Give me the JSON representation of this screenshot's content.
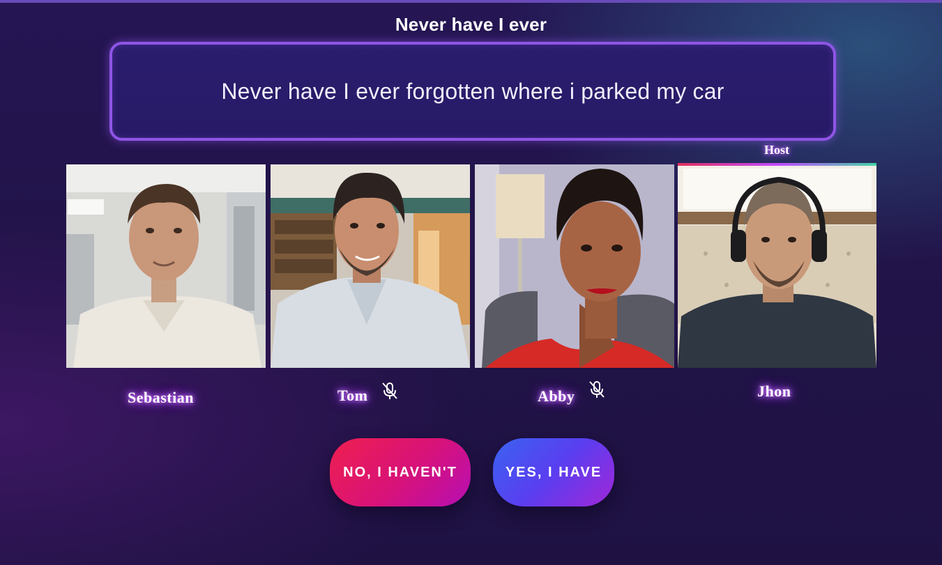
{
  "game": {
    "title": "Never have I ever"
  },
  "question": {
    "text": "Never have I ever forgotten where i parked my car"
  },
  "host_label": "Host",
  "participants": [
    {
      "name": "Sebastian",
      "muted": false,
      "is_host": false
    },
    {
      "name": "Tom",
      "muted": true,
      "is_host": false
    },
    {
      "name": "Abby",
      "muted": true,
      "is_host": false
    },
    {
      "name": "Jhon",
      "muted": false,
      "is_host": true
    }
  ],
  "actions": {
    "no_label": "NO, I HAVEN'T",
    "yes_label": "YES, I HAVE"
  },
  "icons": {
    "muted": "mic-off-icon"
  },
  "colors": {
    "background": "#231550",
    "question_border": "#8f55e6",
    "no_button": "#e5185e",
    "yes_button": "#4a52ee",
    "name_glow": "#b050ff"
  }
}
